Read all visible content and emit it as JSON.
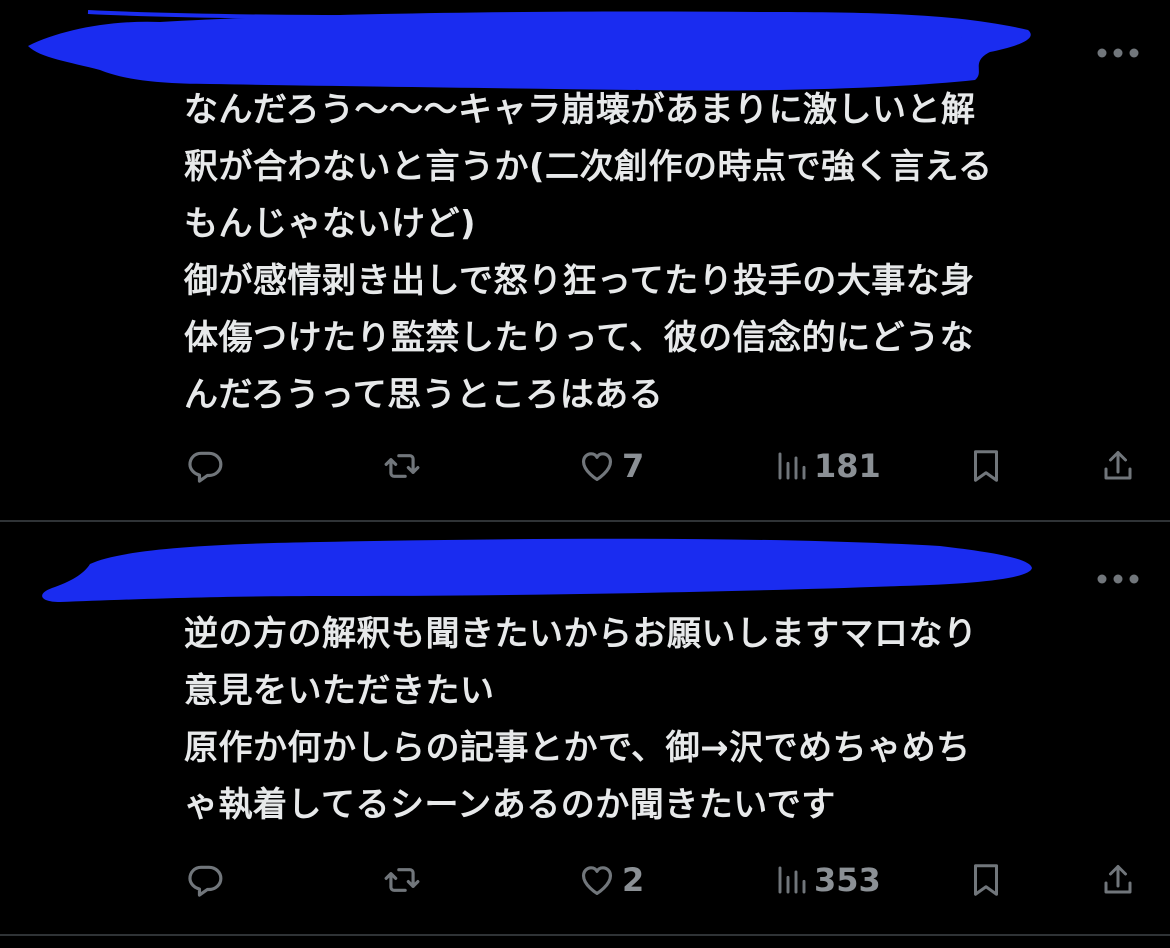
{
  "tweets": [
    {
      "text": "なんだろう〜〜〜キャラ崩壊があまりに激しいと解\n釈が合わないと言うか(二次創作の時点で強く言える\nもんじゃないけど)\n御が感情剥き出しで怒り狂ってたり投手の大事な身\n体傷つけたり監禁したりって、彼の信念的にどうな\nんだろうって思うところはある",
      "likes": "7",
      "views": "181",
      "icons": {
        "more": "more-horizontal-icon",
        "reply": "reply-icon",
        "retweet": "retweet-icon",
        "like": "heart-icon",
        "views": "views-chart-icon",
        "bookmark": "bookmark-icon",
        "share": "share-icon"
      }
    },
    {
      "text": "逆の方の解釈も聞きたいからお願いしますマロなり\n意見をいただきたい\n原作か何かしらの記事とかで、御→沢でめちゃめち\nゃ執着してるシーンあるのか聞きたいです",
      "likes": "2",
      "views": "353",
      "icons": {
        "more": "more-horizontal-icon",
        "reply": "reply-icon",
        "retweet": "retweet-icon",
        "like": "heart-icon",
        "views": "views-chart-icon",
        "bookmark": "bookmark-icon",
        "share": "share-icon"
      }
    }
  ],
  "colors": {
    "background": "#000000",
    "text": "#e7e9ea",
    "icon": "#71767b",
    "divider": "#2f3336",
    "redaction": "#1a2cf0"
  }
}
